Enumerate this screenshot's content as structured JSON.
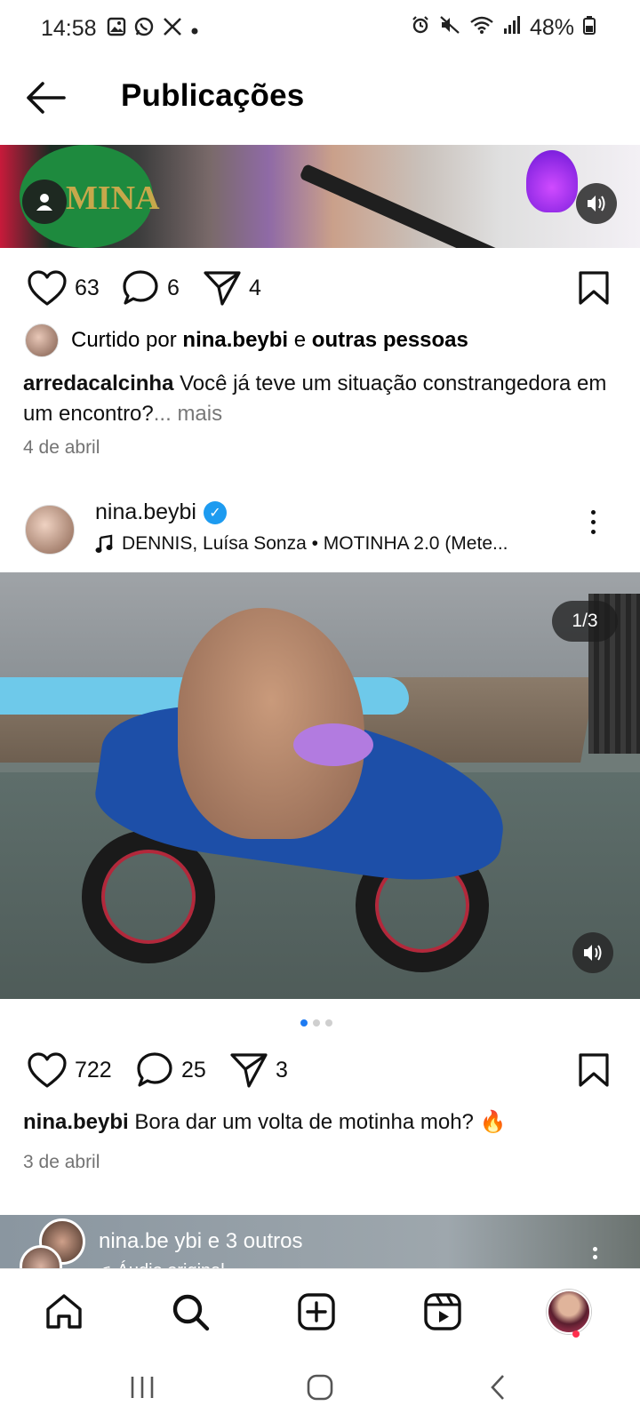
{
  "status_bar": {
    "time": "14:58",
    "notification_icons": [
      "gallery-icon",
      "whatsapp-icon",
      "x-icon",
      "dot-icon"
    ],
    "system_icons": [
      "alarm-icon",
      "mute-icon",
      "wifi-icon",
      "signal-icon"
    ],
    "battery": "48%"
  },
  "header": {
    "title": "Publicações"
  },
  "post1": {
    "media_logo_text": "MINA",
    "likes": "63",
    "comments": "6",
    "shares": "4",
    "liked_by_prefix": "Curtido por",
    "liked_by_user": "nina.beybi",
    "liked_by_and": "e",
    "liked_by_others": "outras pessoas",
    "author": "arredacalcinha",
    "caption": "Você já teve um situação constrangedora em um encontro?",
    "more": "... mais",
    "date": "4 de abril"
  },
  "post2": {
    "username": "nina.beybi",
    "music": "DENNIS, Luísa Sonza • MOTINHA 2.0 (Mete...",
    "pager": "1/3",
    "carousel": {
      "count": 3,
      "active": 1
    },
    "likes": "722",
    "comments": "25",
    "shares": "3",
    "author": "nina.beybi",
    "caption": "Bora dar um volta de motinha moh? 🔥",
    "date": "3 de abril"
  },
  "post3": {
    "title": "nina.be ybi e 3 outros",
    "subtitle": "♫ Áudio original"
  },
  "nav": {
    "items": [
      "home-icon",
      "search-icon",
      "create-icon",
      "reels-icon",
      "profile-avatar"
    ]
  },
  "colors": {
    "accent": "#1e7bf2",
    "verified": "#1d9bf0",
    "notification": "#ff2e4d"
  }
}
